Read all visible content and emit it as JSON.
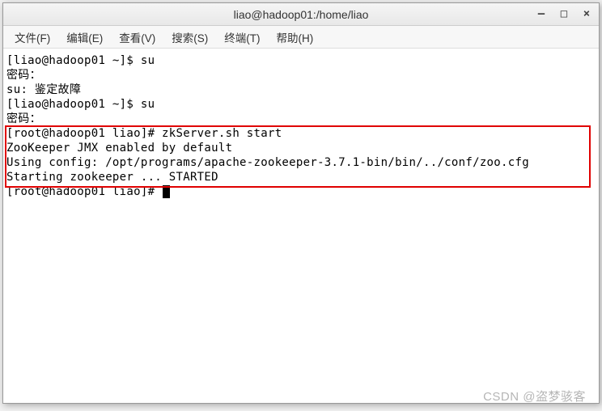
{
  "titlebar": {
    "title": "liao@hadoop01:/home/liao",
    "minimize": "–",
    "maximize": "□",
    "close": "×"
  },
  "menubar": {
    "file": "文件(F)",
    "edit": "编辑(E)",
    "view": "查看(V)",
    "search": "搜索(S)",
    "terminal": "终端(T)",
    "help": "帮助(H)"
  },
  "terminal": {
    "line1": "[liao@hadoop01 ~]$ su",
    "line2": "密码：",
    "line3": "su: 鉴定故障",
    "line4": "[liao@hadoop01 ~]$ su",
    "line5": "密码：",
    "line6": "[root@hadoop01 liao]# zkServer.sh start",
    "line7": "ZooKeeper JMX enabled by default",
    "line8": "Using config: /opt/programs/apache-zookeeper-3.7.1-bin/bin/../conf/zoo.cfg",
    "line9": "Starting zookeeper ... STARTED",
    "line10": "[root@hadoop01 liao]# "
  },
  "watermark": "CSDN @盗梦骇客"
}
